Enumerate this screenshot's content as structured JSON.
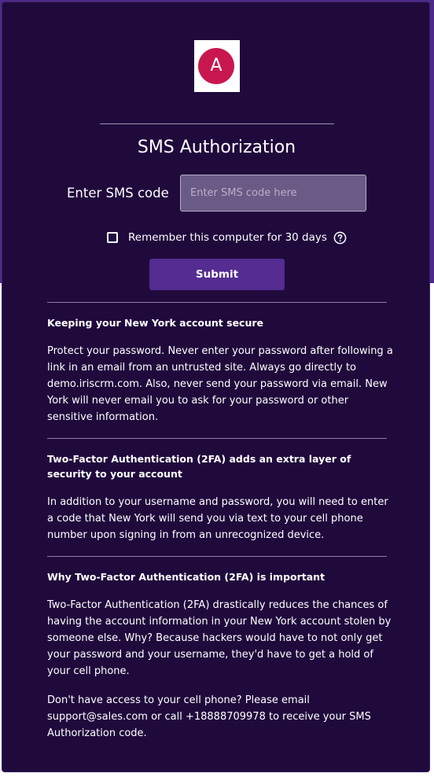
{
  "logo": {
    "letter": "A"
  },
  "title": "SMS Authorization",
  "form": {
    "code_label": "Enter SMS code",
    "code_placeholder": "Enter SMS code here",
    "remember_label": "Remember this computer for 30 days",
    "submit_label": "Submit"
  },
  "sections": [
    {
      "heading": "Keeping your New York account secure",
      "paragraphs": [
        "Protect your password. Never enter your password after following a link in an email from an untrusted site. Always go directly to demo.iriscrm.com. Also, never send your password via email. New York will never email you to ask for your password or other sensitive information."
      ]
    },
    {
      "heading": "Two-Factor Authentication (2FA) adds an extra layer of security to your account",
      "paragraphs": [
        "In addition to your username and password, you will need to enter a code that New York will send you via text to your cell phone number upon signing in from an unrecognized device."
      ]
    },
    {
      "heading": "Why Two-Factor Authentication (2FA) is important",
      "paragraphs": [
        "Two-Factor Authentication (2FA) drastically reduces the chances of having the account information in your New York account stolen by someone else. Why? Because hackers would have to not only get your password and your username, they'd have to get a hold of your cell phone.",
        "Don't have access to your cell phone? Please email support@sales.com or call +18888709978 to receive your SMS Authorization code."
      ]
    }
  ],
  "colors": {
    "card_background": "#200a3c",
    "band_background": "#4d2a8a",
    "button_background": "#542c92",
    "logo_circle": "#c8174f"
  },
  "icons": {
    "logo": "brand-logo-icon",
    "help": "question-circle-icon"
  }
}
